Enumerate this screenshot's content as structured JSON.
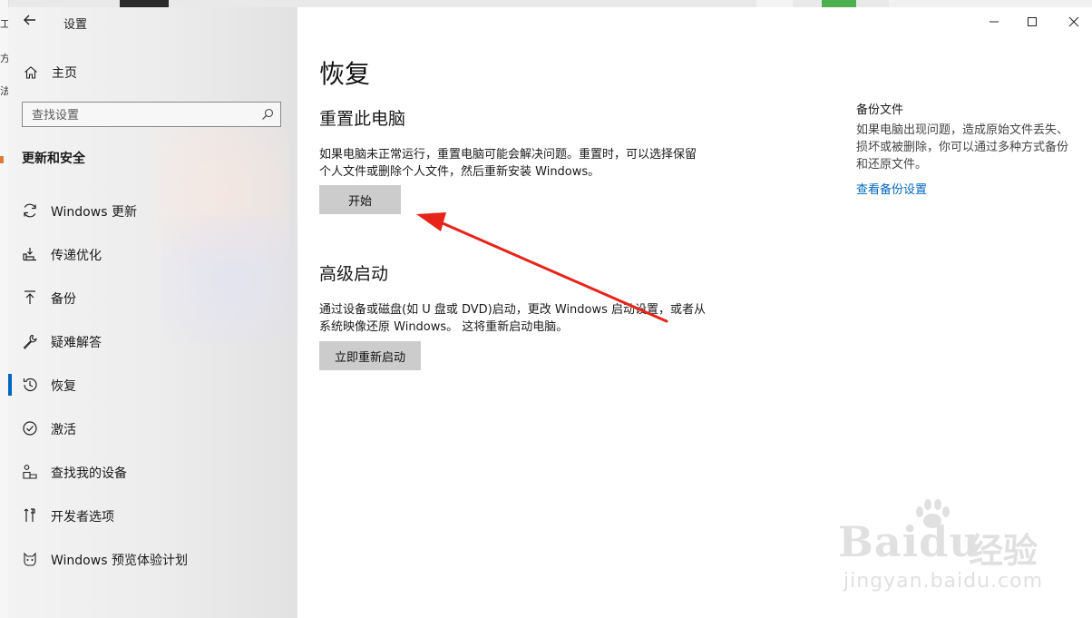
{
  "background": {
    "left_fragments": [
      "工",
      "方",
      "法"
    ]
  },
  "window": {
    "title": "设置",
    "controls": [
      "minimize-icon",
      "maximize-icon",
      "close-icon"
    ]
  },
  "sidebar": {
    "home_label": "主页",
    "search_placeholder": "查找设置",
    "section_title": "更新和安全",
    "items": [
      {
        "label": "Windows 更新",
        "icon": "refresh-icon"
      },
      {
        "label": "传递优化",
        "icon": "delivery-optimization-icon"
      },
      {
        "label": "备份",
        "icon": "backup-arrow-icon"
      },
      {
        "label": "疑难解答",
        "icon": "wrench-icon"
      },
      {
        "label": "恢复",
        "icon": "recovery-history-icon",
        "active": true
      },
      {
        "label": "激活",
        "icon": "check-circle-icon"
      },
      {
        "label": "查找我的设备",
        "icon": "person-device-icon"
      },
      {
        "label": "开发者选项",
        "icon": "developer-tools-icon"
      },
      {
        "label": "Windows 预览体验计划",
        "icon": "insider-cat-icon"
      }
    ]
  },
  "main": {
    "page_title": "恢复",
    "reset": {
      "heading": "重置此电脑",
      "description_line1": "如果电脑未正常运行，重置电脑可能会解决问题。重置时，可以选择保留",
      "description_line2": "个人文件或删除个人文件，然后重新安装 Windows。",
      "button": "开始"
    },
    "advanced": {
      "heading": "高级启动",
      "description_line1": "通过设备或磁盘(如 U 盘或 DVD)启动，更改 Windows 启动设置，或者从",
      "description_line2": "系统映像还原 Windows。 这将重新启动电脑。",
      "button": "立即重新启动"
    }
  },
  "related": {
    "title": "备份文件",
    "text": "如果电脑出现问题，造成原始文件丢失、损坏或被删除，你可以通过多种方式备份和还原文件。",
    "link": "查看备份设置"
  },
  "watermark": {
    "brand": "Baidu",
    "brand_cn": "经验",
    "url": "jingyan.baidu.com"
  },
  "colors": {
    "accent": "#0067c0",
    "annotation_arrow": "#e8231a",
    "button_bg": "#cccccc"
  }
}
